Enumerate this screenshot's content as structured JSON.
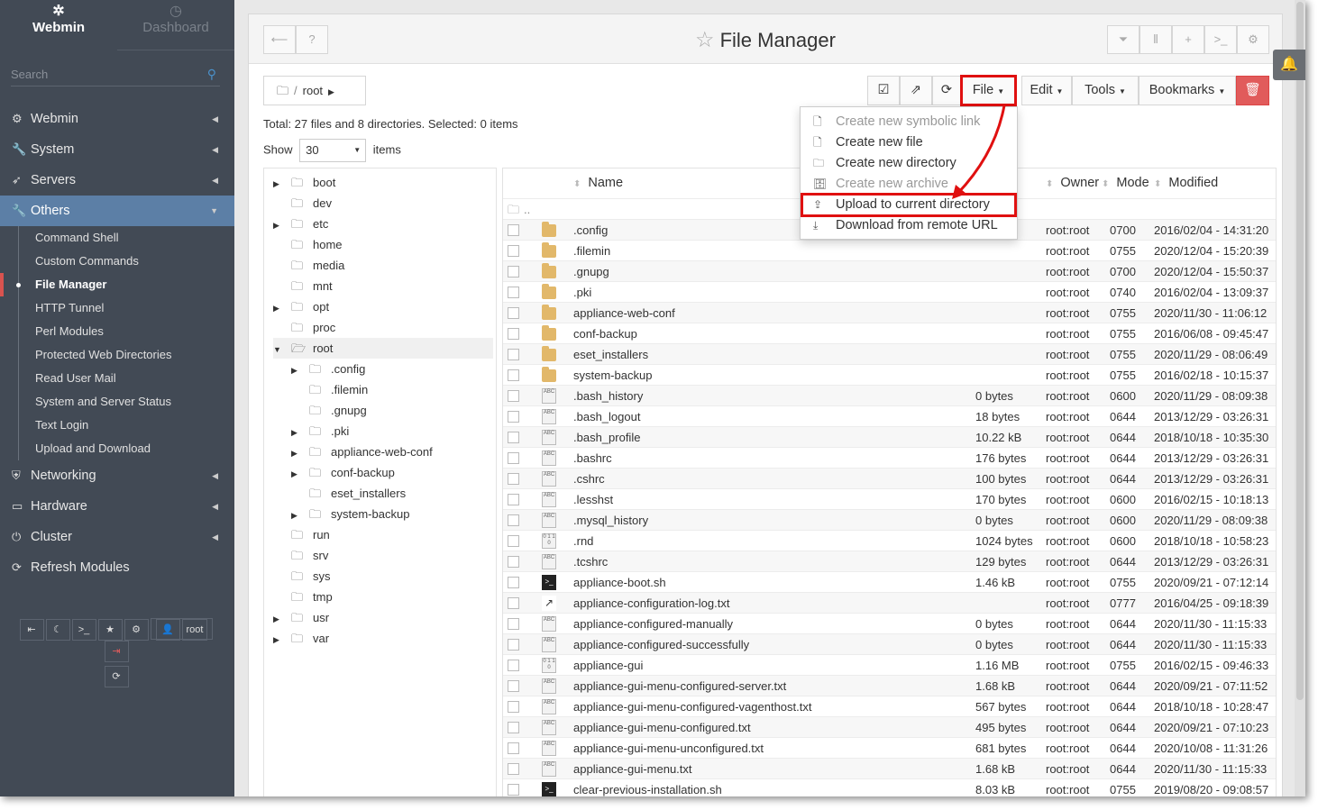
{
  "sidebar": {
    "brand": "Webmin",
    "dashboard": "Dashboard",
    "search_placeholder": "Search",
    "menu": [
      {
        "label": "Webmin",
        "icon": "gear-icon"
      },
      {
        "label": "System",
        "icon": "wrench-icon"
      },
      {
        "label": "Servers",
        "icon": "rocket-icon"
      },
      {
        "label": "Others",
        "icon": "wrench-icon"
      }
    ],
    "others_items": [
      "Command Shell",
      "Custom Commands",
      "File Manager",
      "HTTP Tunnel",
      "Perl Modules",
      "Protected Web Directories",
      "Read User Mail",
      "System and Server Status",
      "Text Login",
      "Upload and Download"
    ],
    "menu2": [
      {
        "label": "Networking",
        "icon": "shield-icon"
      },
      {
        "label": "Hardware",
        "icon": "hdd-icon"
      },
      {
        "label": "Cluster",
        "icon": "power-icon"
      },
      {
        "label": "Refresh Modules",
        "icon": "refresh-icon"
      }
    ],
    "user": "root"
  },
  "header": {
    "title": "File Manager"
  },
  "breadcrumb": {
    "path": "root"
  },
  "toolbar": {
    "file": "File",
    "edit": "Edit",
    "tools": "Tools",
    "bookmarks": "Bookmarks"
  },
  "summary": "Total: 27 files and 8 directories. Selected: 0 items",
  "show": {
    "label": "Show",
    "value": "30",
    "suffix": "items"
  },
  "tree": [
    {
      "name": "boot",
      "depth": 0,
      "caret": true
    },
    {
      "name": "dev",
      "depth": 0,
      "caret": false
    },
    {
      "name": "etc",
      "depth": 0,
      "caret": true
    },
    {
      "name": "home",
      "depth": 0,
      "caret": false
    },
    {
      "name": "media",
      "depth": 0,
      "caret": false
    },
    {
      "name": "mnt",
      "depth": 0,
      "caret": false
    },
    {
      "name": "opt",
      "depth": 0,
      "caret": true
    },
    {
      "name": "proc",
      "depth": 0,
      "caret": false
    },
    {
      "name": "root",
      "depth": 0,
      "caret": "open"
    },
    {
      "name": ".config",
      "depth": 1,
      "caret": true
    },
    {
      "name": ".filemin",
      "depth": 1,
      "caret": false
    },
    {
      "name": ".gnupg",
      "depth": 1,
      "caret": false
    },
    {
      "name": ".pki",
      "depth": 1,
      "caret": true
    },
    {
      "name": "appliance-web-conf",
      "depth": 1,
      "caret": true
    },
    {
      "name": "conf-backup",
      "depth": 1,
      "caret": true
    },
    {
      "name": "eset_installers",
      "depth": 1,
      "caret": false
    },
    {
      "name": "system-backup",
      "depth": 1,
      "caret": true
    },
    {
      "name": "run",
      "depth": 0,
      "caret": false
    },
    {
      "name": "srv",
      "depth": 0,
      "caret": false
    },
    {
      "name": "sys",
      "depth": 0,
      "caret": false
    },
    {
      "name": "tmp",
      "depth": 0,
      "caret": false
    },
    {
      "name": "usr",
      "depth": 0,
      "caret": true
    },
    {
      "name": "var",
      "depth": 0,
      "caret": true
    }
  ],
  "columns": {
    "name": "Name",
    "owner": "Owner",
    "mode": "Mode",
    "modified": "Modified"
  },
  "parent_row": "..",
  "files": [
    {
      "name": ".config",
      "type": "dir",
      "size": "",
      "owner": "root:root",
      "mode": "0700",
      "modified": "2016/02/04 - 14:31:20"
    },
    {
      "name": ".filemin",
      "type": "dir",
      "size": "",
      "owner": "root:root",
      "mode": "0755",
      "modified": "2020/12/04 - 15:20:39"
    },
    {
      "name": ".gnupg",
      "type": "dir",
      "size": "",
      "owner": "root:root",
      "mode": "0700",
      "modified": "2020/12/04 - 15:50:37"
    },
    {
      "name": ".pki",
      "type": "dir",
      "size": "",
      "owner": "root:root",
      "mode": "0740",
      "modified": "2016/02/04 - 13:09:37"
    },
    {
      "name": "appliance-web-conf",
      "type": "dir",
      "size": "",
      "owner": "root:root",
      "mode": "0755",
      "modified": "2020/11/30 - 11:06:12"
    },
    {
      "name": "conf-backup",
      "type": "dir",
      "size": "",
      "owner": "root:root",
      "mode": "0755",
      "modified": "2016/06/08 - 09:45:47"
    },
    {
      "name": "eset_installers",
      "type": "dir",
      "size": "",
      "owner": "root:root",
      "mode": "0755",
      "modified": "2020/11/29 - 08:06:49"
    },
    {
      "name": "system-backup",
      "type": "dir",
      "size": "",
      "owner": "root:root",
      "mode": "0755",
      "modified": "2016/02/18 - 10:15:37"
    },
    {
      "name": ".bash_history",
      "type": "txt",
      "size": "0 bytes",
      "owner": "root:root",
      "mode": "0600",
      "modified": "2020/11/29 - 08:09:38"
    },
    {
      "name": ".bash_logout",
      "type": "txt",
      "size": "18 bytes",
      "owner": "root:root",
      "mode": "0644",
      "modified": "2013/12/29 - 03:26:31"
    },
    {
      "name": ".bash_profile",
      "type": "txt",
      "size": "10.22 kB",
      "owner": "root:root",
      "mode": "0644",
      "modified": "2018/10/18 - 10:35:30"
    },
    {
      "name": ".bashrc",
      "type": "txt",
      "size": "176 bytes",
      "owner": "root:root",
      "mode": "0644",
      "modified": "2013/12/29 - 03:26:31"
    },
    {
      "name": ".cshrc",
      "type": "txt",
      "size": "100 bytes",
      "owner": "root:root",
      "mode": "0644",
      "modified": "2013/12/29 - 03:26:31"
    },
    {
      "name": ".lesshst",
      "type": "txt",
      "size": "170 bytes",
      "owner": "root:root",
      "mode": "0600",
      "modified": "2016/02/15 - 10:18:13"
    },
    {
      "name": ".mysql_history",
      "type": "txt",
      "size": "0 bytes",
      "owner": "root:root",
      "mode": "0600",
      "modified": "2020/11/29 - 08:09:38"
    },
    {
      "name": ".rnd",
      "type": "bin",
      "size": "1024 bytes",
      "owner": "root:root",
      "mode": "0600",
      "modified": "2018/10/18 - 10:58:23"
    },
    {
      "name": ".tcshrc",
      "type": "txt",
      "size": "129 bytes",
      "owner": "root:root",
      "mode": "0644",
      "modified": "2013/12/29 - 03:26:31"
    },
    {
      "name": "appliance-boot.sh",
      "type": "sh",
      "size": "1.46 kB",
      "owner": "root:root",
      "mode": "0755",
      "modified": "2020/09/21 - 07:12:14"
    },
    {
      "name": "appliance-configuration-log.txt",
      "type": "lnk",
      "size": "",
      "owner": "root:root",
      "mode": "0777",
      "modified": "2016/04/25 - 09:18:39"
    },
    {
      "name": "appliance-configured-manually",
      "type": "txt",
      "size": "0 bytes",
      "owner": "root:root",
      "mode": "0644",
      "modified": "2020/11/30 - 11:15:33"
    },
    {
      "name": "appliance-configured-successfully",
      "type": "txt",
      "size": "0 bytes",
      "owner": "root:root",
      "mode": "0644",
      "modified": "2020/11/30 - 11:15:33"
    },
    {
      "name": "appliance-gui",
      "type": "bin",
      "size": "1.16 MB",
      "owner": "root:root",
      "mode": "0755",
      "modified": "2016/02/15 - 09:46:33"
    },
    {
      "name": "appliance-gui-menu-configured-server.txt",
      "type": "txt",
      "size": "1.68 kB",
      "owner": "root:root",
      "mode": "0644",
      "modified": "2020/09/21 - 07:11:52"
    },
    {
      "name": "appliance-gui-menu-configured-vagenthost.txt",
      "type": "txt",
      "size": "567 bytes",
      "owner": "root:root",
      "mode": "0644",
      "modified": "2018/10/18 - 10:28:47"
    },
    {
      "name": "appliance-gui-menu-configured.txt",
      "type": "txt",
      "size": "495 bytes",
      "owner": "root:root",
      "mode": "0644",
      "modified": "2020/09/21 - 07:10:23"
    },
    {
      "name": "appliance-gui-menu-unconfigured.txt",
      "type": "txt",
      "size": "681 bytes",
      "owner": "root:root",
      "mode": "0644",
      "modified": "2020/10/08 - 11:31:26"
    },
    {
      "name": "appliance-gui-menu.txt",
      "type": "txt",
      "size": "1.68 kB",
      "owner": "root:root",
      "mode": "0644",
      "modified": "2020/11/30 - 11:15:33"
    },
    {
      "name": "clear-previous-installation.sh",
      "type": "sh",
      "size": "8.03 kB",
      "owner": "root:root",
      "mode": "0755",
      "modified": "2019/08/20 - 09:08:57"
    }
  ],
  "file_menu": [
    {
      "label": "Create new symbolic link",
      "disabled": true,
      "icon": "link-file-icon"
    },
    {
      "label": "Create new file",
      "disabled": false,
      "icon": "file-icon"
    },
    {
      "label": "Create new directory",
      "disabled": false,
      "icon": "folder-icon"
    },
    {
      "label": "Create new archive",
      "disabled": true,
      "icon": "archive-icon"
    },
    {
      "label": "Upload to current directory",
      "disabled": false,
      "icon": "upload-icon",
      "highlight": true
    },
    {
      "label": "Download from remote URL",
      "disabled": false,
      "icon": "download-icon"
    }
  ],
  "colors": {
    "sidebar": "#424a55",
    "active": "#5c7fa6",
    "highlight": "#e01010",
    "delete": "#e15b5b"
  }
}
